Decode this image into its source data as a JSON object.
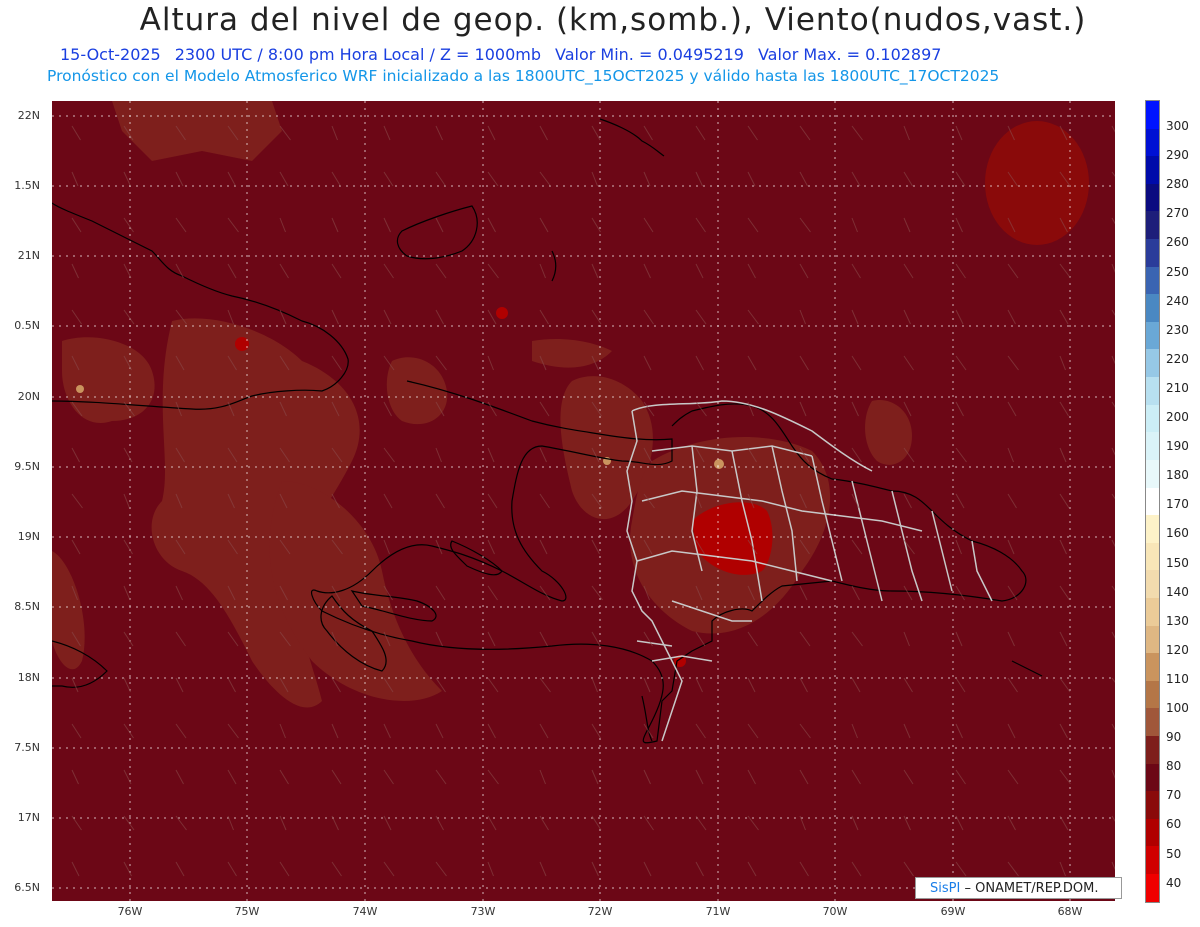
{
  "header": {
    "title": "Altura del nivel de geop. (km,somb.), Viento(nudos,vast.)",
    "date": "15-Oct-2025",
    "time": "2300 UTC / 8:00 pm Hora Local / Z = 1000mb",
    "min": "Valor Min. = 0.0495219",
    "max": "Valor Max. = 0.102897",
    "forecast": "Pronóstico con el Modelo Atmosferico WRF inicializado a las 1800UTC_15OCT2025 y válido hasta las  1800UTC_17OCT2025"
  },
  "axes": {
    "lat_labels": [
      "22N",
      "1.5N",
      "21N",
      "0.5N",
      "20N",
      "9.5N",
      "19N",
      "8.5N",
      "18N",
      "7.5N",
      "17N",
      "6.5N"
    ],
    "lon_labels": [
      "76W",
      "75W",
      "74W",
      "73W",
      "72W",
      "71W",
      "70W",
      "69W",
      "68W"
    ]
  },
  "colorbar": {
    "labels": [
      "300",
      "290",
      "280",
      "270",
      "260",
      "250",
      "240",
      "230",
      "220",
      "210",
      "200",
      "190",
      "180",
      "170",
      "160",
      "150",
      "140",
      "130",
      "120",
      "110",
      "100",
      "90",
      "80",
      "70",
      "60",
      "50",
      "40"
    ],
    "colors": [
      "#0013ff",
      "#0010d4",
      "#000aaa",
      "#0a0a80",
      "#1d1e7a",
      "#2a3c9a",
      "#3a64b2",
      "#4a88c2",
      "#6aa8d6",
      "#96c8e6",
      "#b8e0f0",
      "#cceef6",
      "#daf3f8",
      "#e8f8fa",
      "#ffffff",
      "#fdf2c8",
      "#f8e6b8",
      "#f2dbae",
      "#ebcb98",
      "#dfb783",
      "#ca945e",
      "#b47647",
      "#a0573a",
      "#7e1f1c",
      "#6c0716",
      "#8a0a0a",
      "#b00000",
      "#d00000",
      "#f00000"
    ]
  },
  "credit": {
    "brand": "SisPI",
    "text": "– ONAMET/REP.DOM."
  },
  "colors": {
    "background": "#6c0716",
    "lighter_zone": "#7e1f1c",
    "coast": "#000000",
    "borders": "#c8c8c8",
    "grid": "#ffffff"
  }
}
